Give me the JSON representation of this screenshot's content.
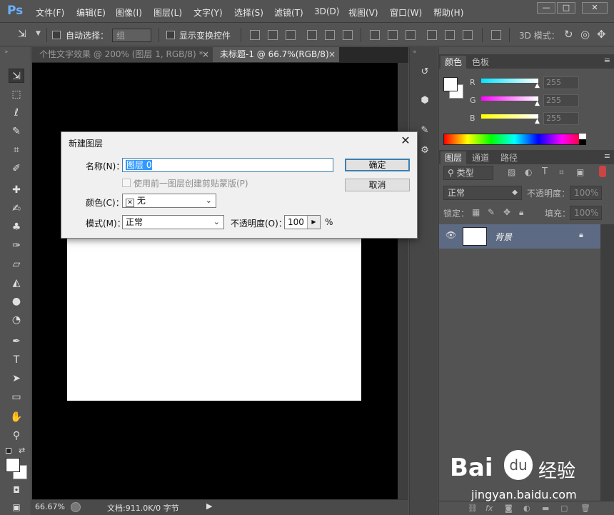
{
  "app": {
    "logo": "Ps"
  },
  "menubar": {
    "items": [
      "文件(F)",
      "编辑(E)",
      "图像(I)",
      "图层(L)",
      "文字(Y)",
      "选择(S)",
      "滤镜(T)",
      "3D(D)",
      "视图(V)",
      "窗口(W)",
      "帮助(H)"
    ],
    "min_label": "—",
    "max_label": "□",
    "close_label": "✕"
  },
  "options": {
    "auto_select_label": "自动选择：",
    "auto_select_value": "组",
    "show_transform_label": "显示变换控件",
    "mode_3d_label": "3D 模式："
  },
  "tabs": [
    {
      "label": "个性文字效果 @ 200% (图层 1, RGB/8) *",
      "close": "×"
    },
    {
      "label": "未标题-1 @ 66.7%(RGB/8)",
      "close": "×"
    }
  ],
  "status": {
    "zoom": "66.67%",
    "doc_info": "文档:911.0K/0 字节"
  },
  "color_panel": {
    "tabs": [
      "颜色",
      "色板"
    ],
    "channels": [
      {
        "name": "R",
        "value": "255",
        "color": "#00e5ff"
      },
      {
        "name": "G",
        "value": "255",
        "color": "#ff00ff"
      },
      {
        "name": "B",
        "value": "255",
        "color": "#ffff00"
      }
    ]
  },
  "layers_panel": {
    "tabs": [
      "图层",
      "通道",
      "路径"
    ],
    "filter_label": "类型",
    "blend_mode": "正常",
    "opacity_label": "不透明度：",
    "opacity_value": "100%",
    "lock_label": "锁定：",
    "fill_label": "填充：",
    "fill_value": "100%",
    "layers": [
      {
        "name": "背景",
        "visible": true,
        "locked": true
      }
    ]
  },
  "dialog": {
    "title": "新建图层",
    "name_label": "名称(N)：",
    "name_value": "图层 0",
    "clip_label": "使用前一图层创建剪贴蒙版(P)",
    "color_label": "颜色(C)：",
    "color_value": "无",
    "mode_label": "模式(M)：",
    "mode_value": "正常",
    "opacity_label": "不透明度(O)：",
    "opacity_value": "100",
    "opacity_unit": "%",
    "ok_label": "确定",
    "cancel_label": "取消",
    "close_label": "✕"
  },
  "watermark": {
    "brand": "Bai",
    "brand_suffix": "经验",
    "url": "jingyan.baidu.com"
  }
}
